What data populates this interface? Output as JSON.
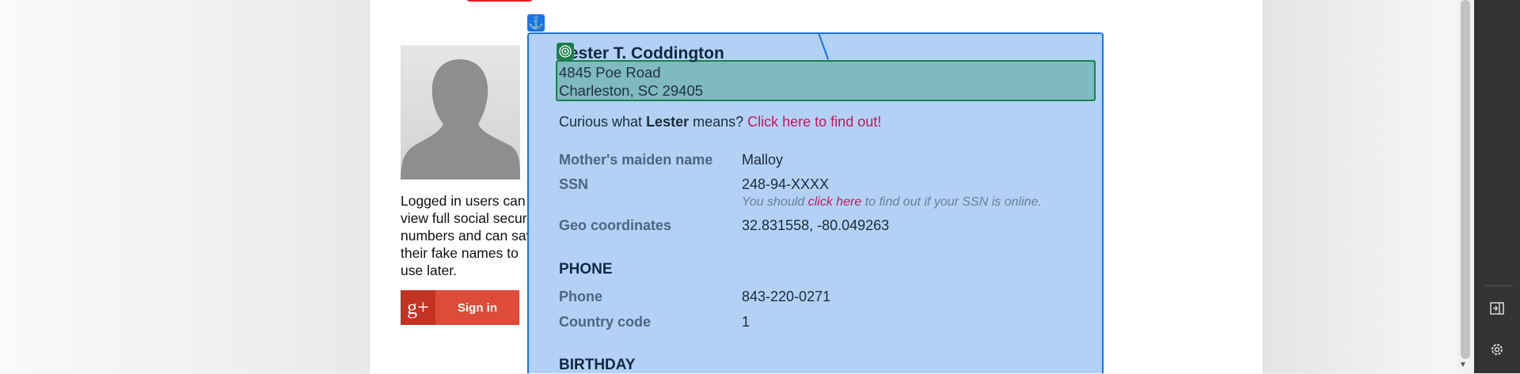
{
  "sidebar": {
    "info_text": "Logged in users can view full social security numbers and can save their fake names to use later.",
    "gplus_glyph": "g+",
    "signin_label": "Sign in"
  },
  "card": {
    "name": "Lester T. Coddington",
    "address_line1": "4845 Poe Road",
    "address_line2": "Charleston, SC 29405",
    "curious_prefix": "Curious what ",
    "curious_name": "Lester",
    "curious_suffix": " means? ",
    "curious_link": "Click here to find out!",
    "maiden_label": "Mother's maiden name",
    "maiden_value": "Malloy",
    "ssn_label": "SSN",
    "ssn_value": "248-94-XXXX",
    "ssn_note_prefix": "You should ",
    "ssn_note_link": "click here",
    "ssn_note_suffix": " to find out if your SSN is online.",
    "geo_label": "Geo coordinates",
    "geo_value": "32.831558, -80.049263",
    "phone_section": "PHONE",
    "phone_label": "Phone",
    "phone_value": "843-220-0271",
    "country_label": "Country code",
    "country_value": "1",
    "birthday_section": "BIRTHDAY"
  },
  "icons": {
    "anchor": "anchor-icon",
    "target": "target-icon",
    "sidebar_toggle": "panel-toggle-icon",
    "settings": "gear-icon"
  },
  "colors": {
    "card_bg": "#b3d1f5",
    "card_border": "#1a73e8",
    "address_bg": "#7fb9c1",
    "address_border": "#1b7f4a",
    "link": "#c2185b",
    "gplus": "#dd4b39"
  }
}
